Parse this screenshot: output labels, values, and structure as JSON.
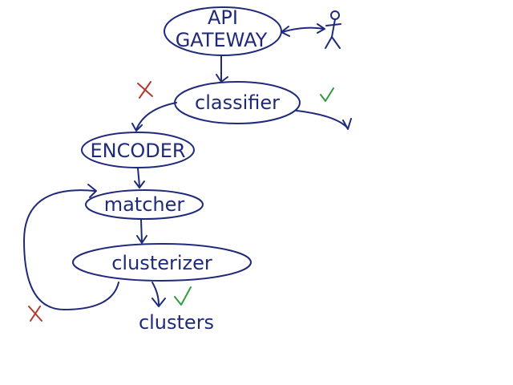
{
  "nodes": {
    "api_gateway_line1": "API",
    "api_gateway_line2": "GATEWAY",
    "classifier": "classifier",
    "encoder": "ENCODER",
    "matcher": "matcher",
    "clusterizer": "clusterizer",
    "clusters": "clusters"
  },
  "colors": {
    "ink": "#1f2a7a",
    "reject": "#b03a2e",
    "accept": "#2e9e3a"
  },
  "icons": {
    "user": "stick-figure-icon",
    "reject": "x-mark-icon",
    "accept": "check-mark-icon"
  }
}
